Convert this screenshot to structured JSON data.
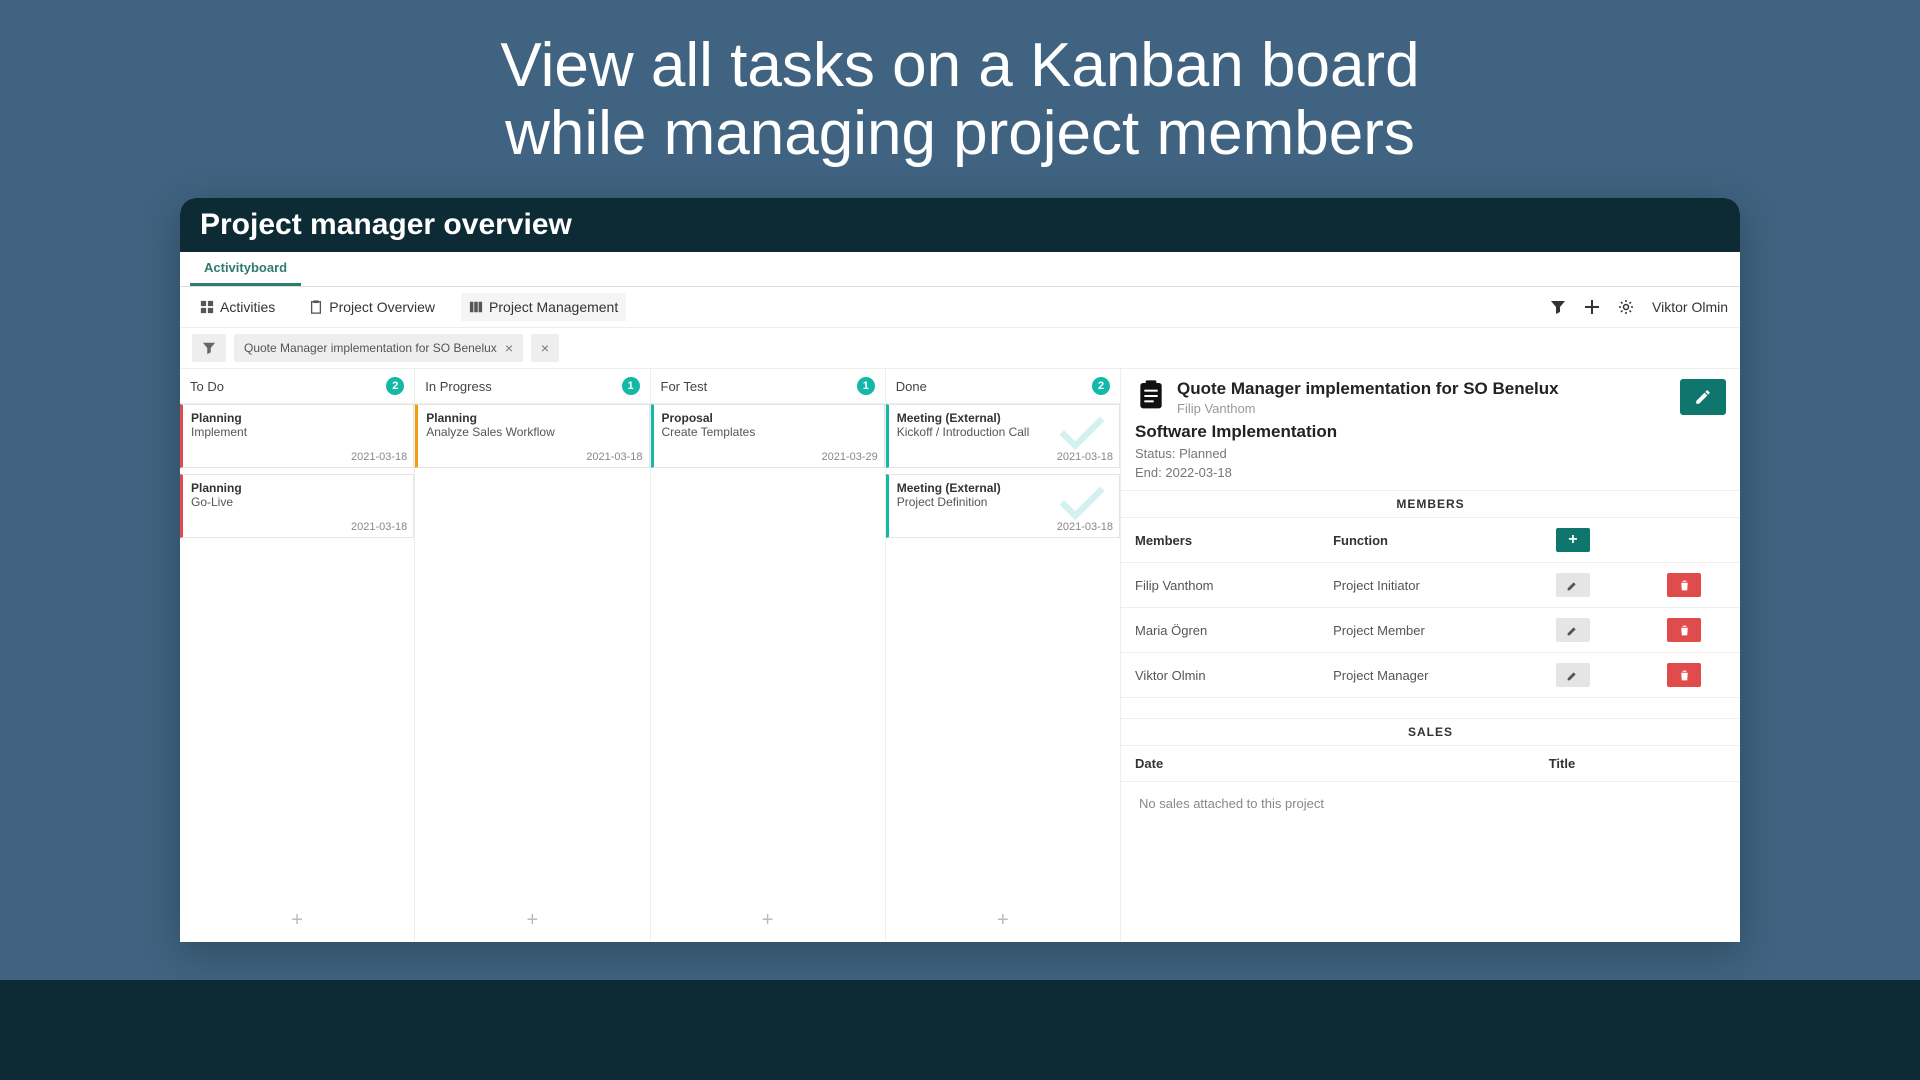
{
  "hero": {
    "line1": "View all tasks on a Kanban board",
    "line2": "while managing project members"
  },
  "app_title": "Project manager overview",
  "tabs": [
    {
      "label": "Activityboard",
      "active": true
    }
  ],
  "toolbar": {
    "items": [
      {
        "label": "Activities"
      },
      {
        "label": "Project Overview"
      },
      {
        "label": "Project Management",
        "active": true
      }
    ],
    "user": "Viktor Olmin"
  },
  "filter_chip": {
    "label": "Quote Manager implementation for SO Benelux"
  },
  "columns": [
    {
      "title": "To Do",
      "count": "2",
      "cards": [
        {
          "title": "Planning",
          "desc": "Implement",
          "date": "2021-03-18",
          "color": "red"
        },
        {
          "title": "Planning",
          "desc": "Go-Live",
          "date": "2021-03-18",
          "color": "red"
        }
      ]
    },
    {
      "title": "In Progress",
      "count": "1",
      "cards": [
        {
          "title": "Planning",
          "desc": "Analyze Sales Workflow",
          "date": "2021-03-18",
          "color": "orange"
        }
      ]
    },
    {
      "title": "For Test",
      "count": "1",
      "cards": [
        {
          "title": "Proposal",
          "desc": "Create Templates",
          "date": "2021-03-29",
          "color": "teal"
        }
      ]
    },
    {
      "title": "Done",
      "count": "2",
      "cards": [
        {
          "title": "Meeting (External)",
          "desc": "Kickoff / Introduction Call",
          "date": "2021-03-18",
          "color": "done",
          "done": true
        },
        {
          "title": "Meeting (External)",
          "desc": "Project Definition",
          "date": "2021-03-18",
          "color": "done",
          "done": true
        }
      ]
    }
  ],
  "side": {
    "title": "Quote Manager implementation for SO Benelux",
    "owner": "Filip Vanthom",
    "project_type": "Software Implementation",
    "status_label": "Status: Planned",
    "end_label": "End: 2022-03-18",
    "members_heading": "MEMBERS",
    "members_table": {
      "col_members": "Members",
      "col_function": "Function",
      "rows": [
        {
          "name": "Filip Vanthom",
          "role": "Project Initiator"
        },
        {
          "name": "Maria Ögren",
          "role": "Project Member"
        },
        {
          "name": "Viktor Olmin",
          "role": "Project Manager"
        }
      ]
    },
    "sales_heading": "SALES",
    "sales_cols": {
      "date": "Date",
      "title": "Title"
    },
    "sales_empty": "No sales attached to this project"
  }
}
